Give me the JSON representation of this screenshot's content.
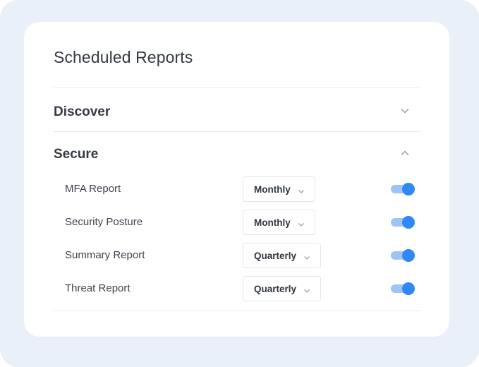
{
  "panel": {
    "title": "Scheduled Reports"
  },
  "sections": [
    {
      "title": "Discover",
      "expanded": false,
      "chevron_icon": "chevron-down-icon"
    },
    {
      "title": "Secure",
      "expanded": true,
      "chevron_icon": "chevron-up-icon"
    }
  ],
  "reports": [
    {
      "name": "MFA Report",
      "frequency": "Monthly",
      "enabled": true
    },
    {
      "name": "Security Posture",
      "frequency": "Monthly",
      "enabled": true
    },
    {
      "name": "Summary Report",
      "frequency": "Quarterly",
      "enabled": true
    },
    {
      "name": "Threat Report",
      "frequency": "Quarterly",
      "enabled": true
    }
  ],
  "colors": {
    "background": "#e9f0f9",
    "toggle_on": "#2f88f4",
    "toggle_track": "#9ec4f5",
    "text": "#343a44"
  }
}
